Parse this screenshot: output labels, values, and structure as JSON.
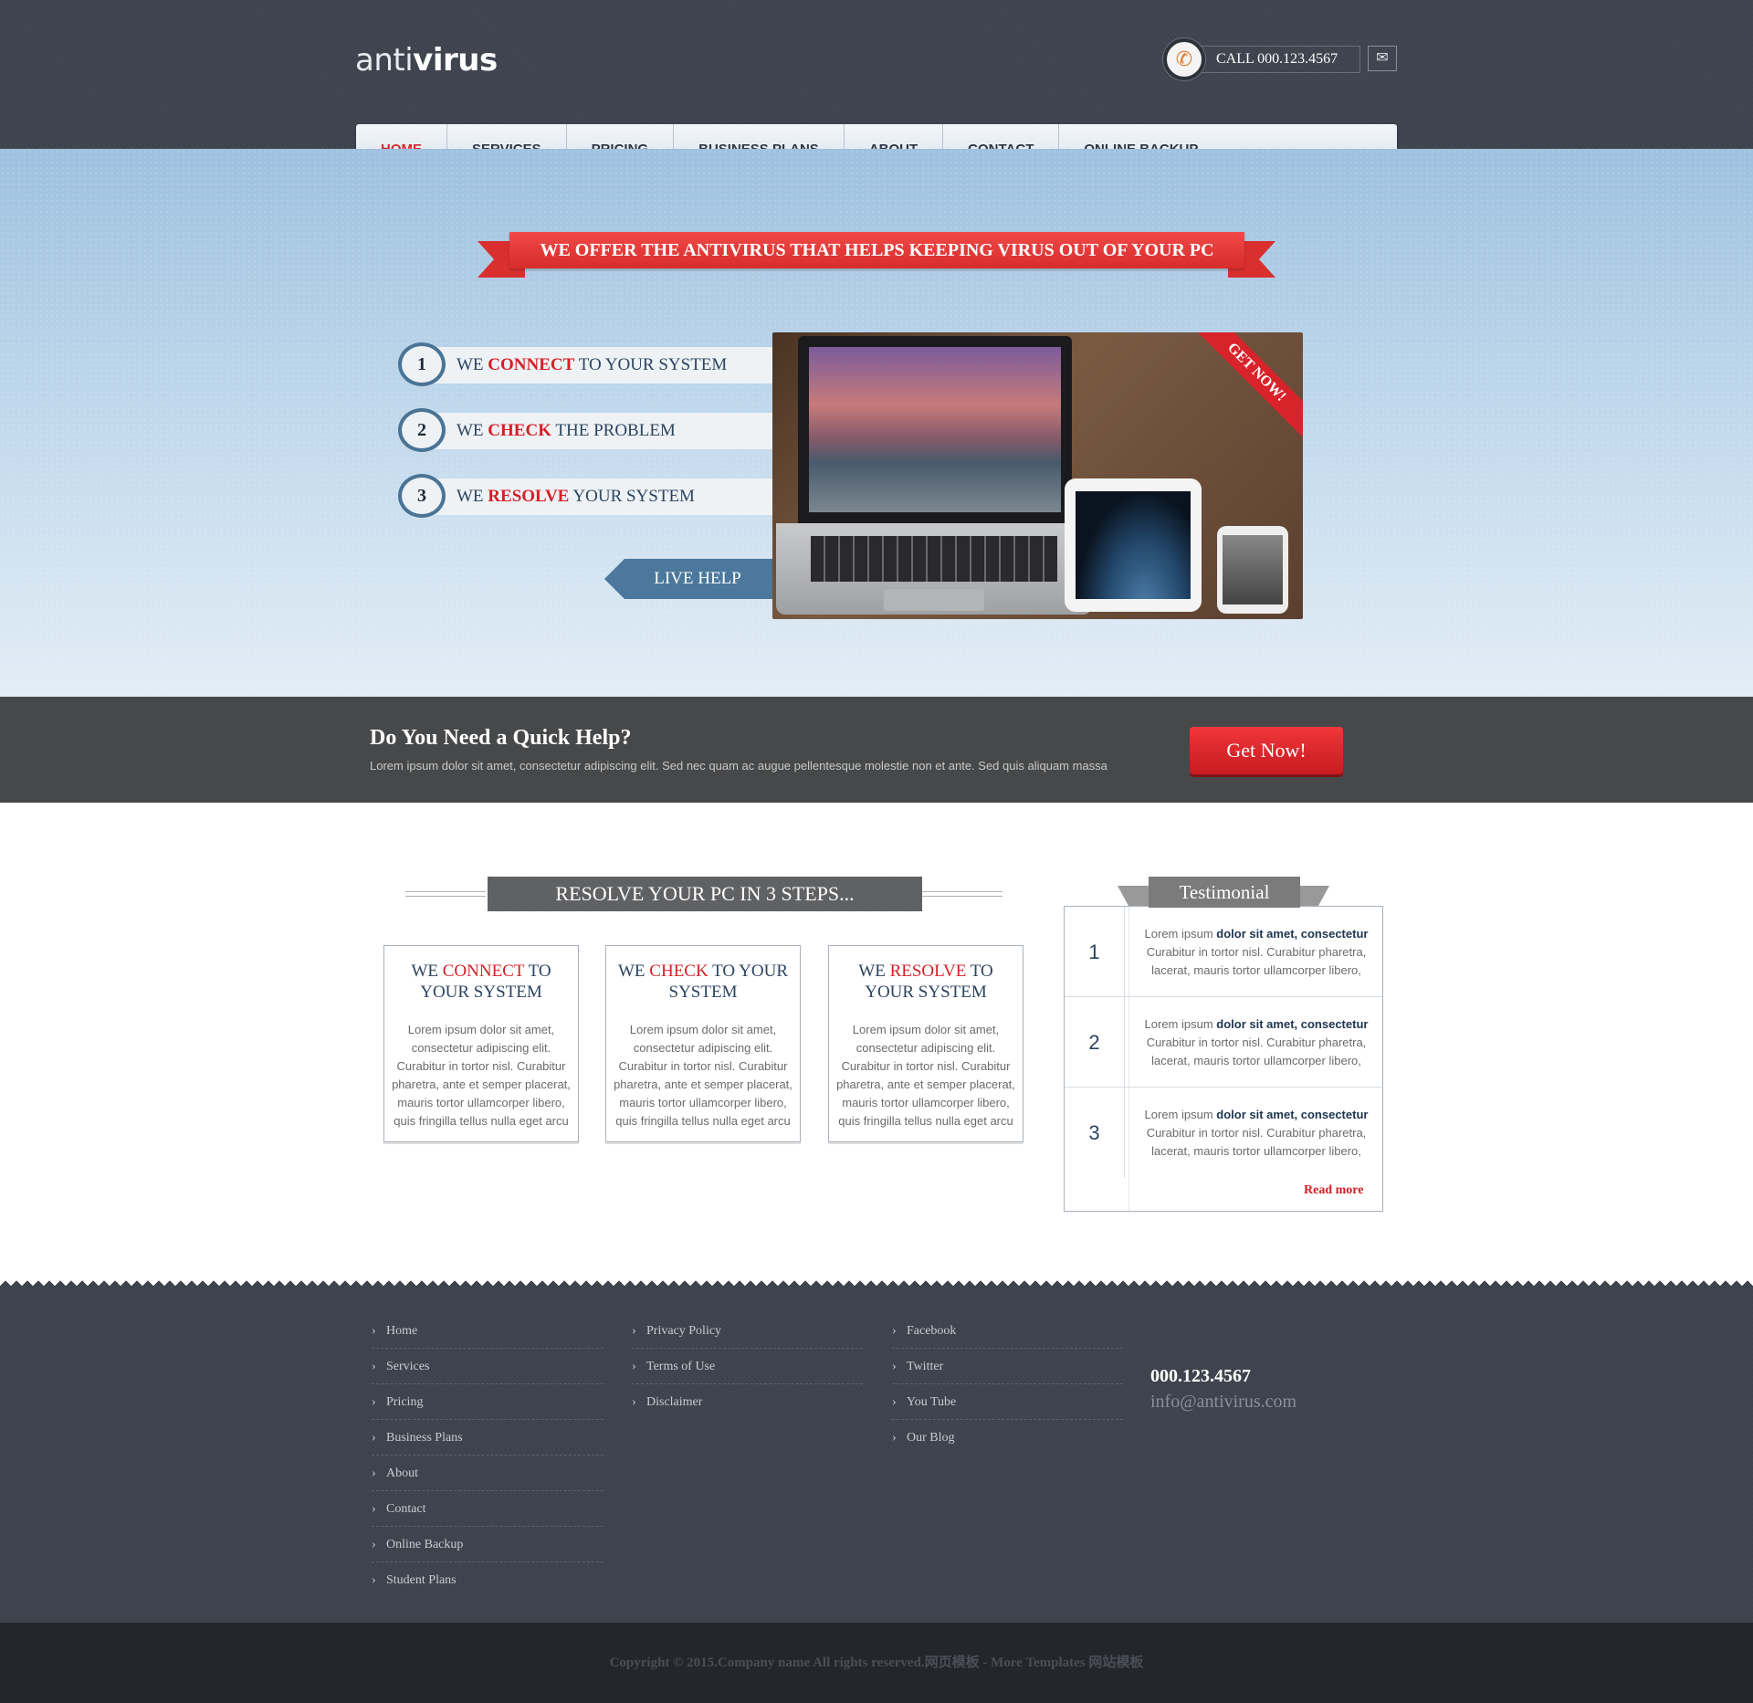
{
  "header": {
    "logo_light": "anti",
    "logo_bold": "virus",
    "phone_label": "CALL 000.123.4567",
    "icons": {
      "phone": "phone-icon",
      "mail": "mail-icon"
    }
  },
  "nav": {
    "items": [
      {
        "label": "HOME",
        "active": true
      },
      {
        "label": "SERVICES"
      },
      {
        "label": "PRICING"
      },
      {
        "label": "BUSINESS PLANS"
      },
      {
        "label": "ABOUT"
      },
      {
        "label": "CONTACT"
      },
      {
        "label": "ONLINE BACKUP"
      }
    ]
  },
  "hero": {
    "ribbon": "WE OFFER THE ANTIVIRUS THAT HELPS KEEPING VIRUS OUT OF YOUR PC",
    "steps": [
      {
        "num": "1",
        "pre": "WE",
        "key": "CONNECT",
        "post": "TO YOUR SYSTEM"
      },
      {
        "num": "2",
        "pre": "WE",
        "key": "CHECK",
        "post": "THE PROBLEM"
      },
      {
        "num": "3",
        "pre": "WE",
        "key": "RESOLVE",
        "post": "YOUR SYSTEM"
      }
    ],
    "live_help": "LIVE HELP",
    "corner_badge": "GET NOW!"
  },
  "quick_help": {
    "title": "Do You Need a Quick Help?",
    "text": "Lorem ipsum dolor sit amet, consectetur adipiscing elit. Sed nec quam ac augue pellentesque molestie non et ante. Sed quis aliquam massa",
    "button": "Get Now!"
  },
  "steps_section": {
    "title": "RESOLVE YOUR PC IN 3 STEPS...",
    "cards": [
      {
        "pre": "WE",
        "key": "CONNECT",
        "post": "TO YOUR SYSTEM",
        "text": "Lorem ipsum dolor sit amet, consectetur adipiscing elit. Curabitur in tortor nisl. Curabitur pharetra, ante et semper placerat, mauris tortor ullamcorper libero, quis fringilla tellus nulla eget arcu"
      },
      {
        "pre": "WE",
        "key": "CHECK",
        "post": "TO YOUR SYSTEM",
        "text": "Lorem ipsum dolor sit amet, consectetur adipiscing elit. Curabitur in tortor nisl. Curabitur pharetra, ante et semper placerat, mauris tortor ullamcorper libero, quis fringilla tellus nulla eget arcu"
      },
      {
        "pre": "WE",
        "key": "RESOLVE",
        "post": "TO YOUR SYSTEM",
        "text": "Lorem ipsum dolor sit amet, consectetur adipiscing elit. Curabitur in tortor nisl. Curabitur pharetra, ante et semper placerat, mauris tortor ullamcorper libero, quis fringilla tellus nulla eget arcu"
      }
    ]
  },
  "testimonial": {
    "title": "Testimonial",
    "items": [
      {
        "num": "1",
        "lead": "Lorem ipsum",
        "bold": "dolor sit amet, consectetur",
        "rest": "Curabitur in tortor nisl. Curabitur pharetra, lacerat, mauris tortor ullamcorper libero,"
      },
      {
        "num": "2",
        "lead": "Lorem ipsum",
        "bold": "dolor sit amet, consectetur",
        "rest": "Curabitur in tortor nisl. Curabitur pharetra, lacerat, mauris tortor ullamcorper libero,"
      },
      {
        "num": "3",
        "lead": "Lorem ipsum",
        "bold": "dolor sit amet, consectetur",
        "rest": "Curabitur in tortor nisl. Curabitur pharetra, lacerat, mauris tortor ullamcorper libero,"
      }
    ],
    "read_more": "Read more"
  },
  "footer": {
    "col1": [
      "Home",
      "Services",
      "Pricing",
      "Business Plans",
      "About",
      "Contact",
      "Online Backup",
      "Student Plans"
    ],
    "col2": [
      "Privacy Policy",
      "Terms of Use",
      "Disclaimer"
    ],
    "col3": [
      "Facebook",
      "Twitter",
      "You Tube",
      "Our Blog"
    ],
    "phone": "000.123.4567",
    "email": "info@antivirus.com",
    "copyright": "Copyright © 2015.Company name All rights reserved.网页模板 - More Templates 网站模板"
  },
  "colors": {
    "accent_red": "#d41f26",
    "dark_header": "#3e434f",
    "nav_active": "#d22a2e"
  }
}
